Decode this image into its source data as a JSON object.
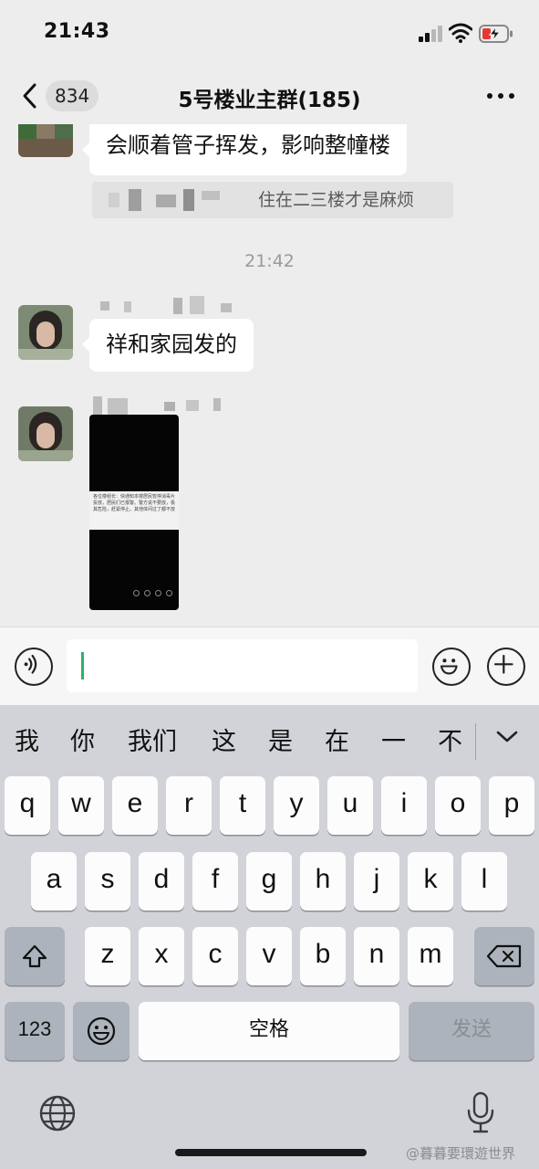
{
  "status_bar": {
    "time": "21:43"
  },
  "header": {
    "back_count": "834",
    "title": "5号楼业主群(185)"
  },
  "messages": {
    "msg1_text": "会顺着管子挥发，影响整幢楼",
    "quote_text": "住在二三楼才是麻烦",
    "time_separator": "21:42",
    "msg2_text": "祥和家园发的",
    "video_notice": "各位楼组长：快通知本楼居民暂停消毒片投放，居民们已报警。警方说不要放，极其危险，赶紧停止。其他体间过了都不放"
  },
  "input": {
    "placeholder": ""
  },
  "keyboard": {
    "candidates": [
      "我",
      "你",
      "我们",
      "这",
      "是",
      "在",
      "一",
      "不"
    ],
    "row1": [
      "q",
      "w",
      "e",
      "r",
      "t",
      "y",
      "u",
      "i",
      "o",
      "p"
    ],
    "row2": [
      "a",
      "s",
      "d",
      "f",
      "g",
      "h",
      "j",
      "k",
      "l"
    ],
    "row3": [
      "z",
      "x",
      "c",
      "v",
      "b",
      "n",
      "m"
    ],
    "numbers_key": "123",
    "space_key": "空格",
    "send_key": "发送"
  },
  "watermark": "@暮暮要環遊世界",
  "colors": {
    "background": "#ededed",
    "bubble": "#ffffff",
    "cursor": "#2ab26a",
    "keyboard_bg": "#d1d3d9"
  },
  "icons": [
    "back-icon",
    "more-icon",
    "voice-icon",
    "emoji-icon",
    "plus-icon",
    "shift-icon",
    "backspace-icon",
    "globe-icon",
    "mic-icon",
    "collapse-keyboard-icon"
  ]
}
